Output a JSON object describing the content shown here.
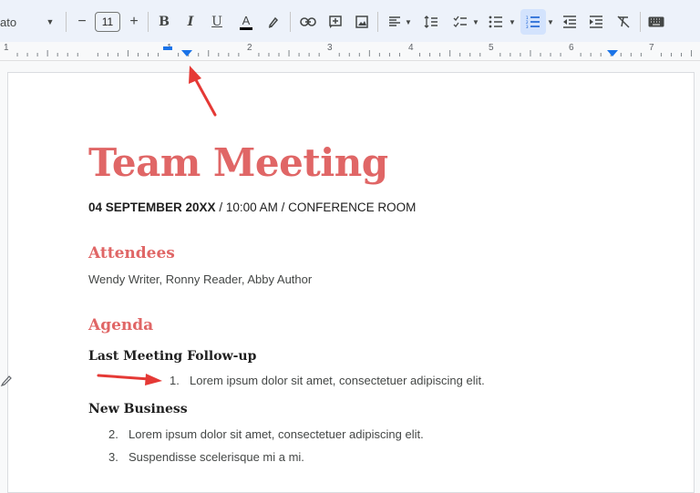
{
  "toolbar": {
    "font_name": "ato",
    "decrease_label": "−",
    "font_size": "11",
    "increase_label": "+",
    "bold_label": "B",
    "italic_label": "I",
    "underline_label": "U",
    "text_color_label": "A"
  },
  "ruler": {
    "numbers": [
      "1",
      "1",
      "2",
      "3",
      "4",
      "5",
      "6",
      "7"
    ]
  },
  "document": {
    "title": "Team Meeting",
    "date_bold": "04 SEPTEMBER 20XX",
    "date_rest": " / 10:00 AM / CONFERENCE ROOM",
    "attendees_heading": "Attendees",
    "attendees_text": "Wendy Writer, Ronny Reader, Abby Author",
    "agenda_heading": "Agenda",
    "section1_heading": "Last Meeting Follow-up",
    "section1_items": [
      {
        "num": "1.",
        "text": "Lorem ipsum dolor sit amet, consectetuer adipiscing elit."
      }
    ],
    "section2_heading": "New Business",
    "section2_items": [
      {
        "num": "2.",
        "text": "Lorem ipsum dolor sit amet, consectetuer adipiscing elit."
      },
      {
        "num": "3.",
        "text": "Suspendisse scelerisque mi a mi."
      }
    ]
  },
  "colors": {
    "accent": "#e06666",
    "arrow": "#e53935",
    "toolbar_bg": "#edf2fa",
    "ruler_marker": "#1a73e8"
  }
}
